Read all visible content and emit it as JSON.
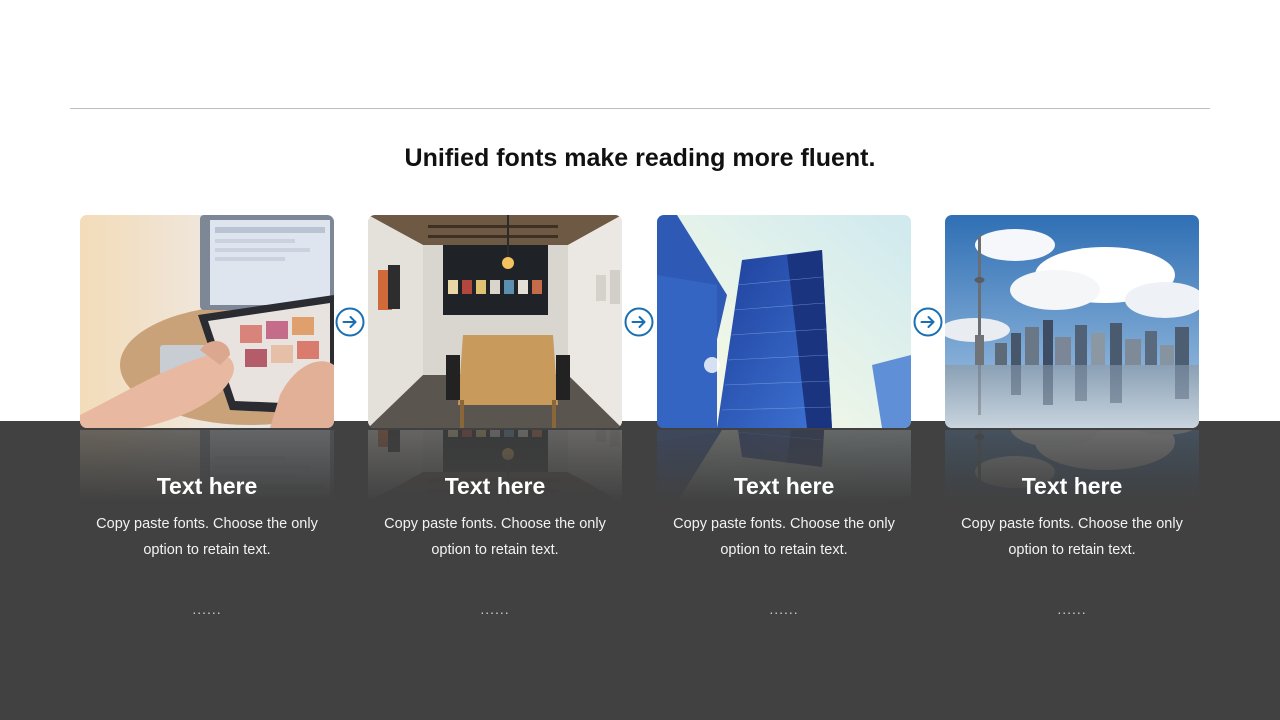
{
  "heading": "Unified fonts make reading more fluent.",
  "columns": [
    {
      "title": "Text here",
      "line1": "Copy paste fonts. Choose the only",
      "line2": "option to retain text.",
      "dots": "......",
      "image": "tablet-photo"
    },
    {
      "title": "Text here",
      "line1": "Copy paste fonts. Choose the only",
      "line2": "option to retain text.",
      "dots": "......",
      "image": "gallery-room-photo"
    },
    {
      "title": "Text here",
      "line1": "Copy paste fonts. Choose the only",
      "line2": "option to retain text.",
      "dots": "......",
      "image": "skyscraper-photo"
    },
    {
      "title": "Text here",
      "line1": "Copy paste fonts. Choose the only",
      "line2": "option to retain text.",
      "dots": "......",
      "image": "city-skyline-photo"
    }
  ],
  "arrows": [
    "arrow-right-circle-icon",
    "arrow-right-circle-icon",
    "arrow-right-circle-icon"
  ],
  "colors": {
    "accent": "#1a6fb3",
    "band": "#414141",
    "rule": "#bdbdbd"
  }
}
